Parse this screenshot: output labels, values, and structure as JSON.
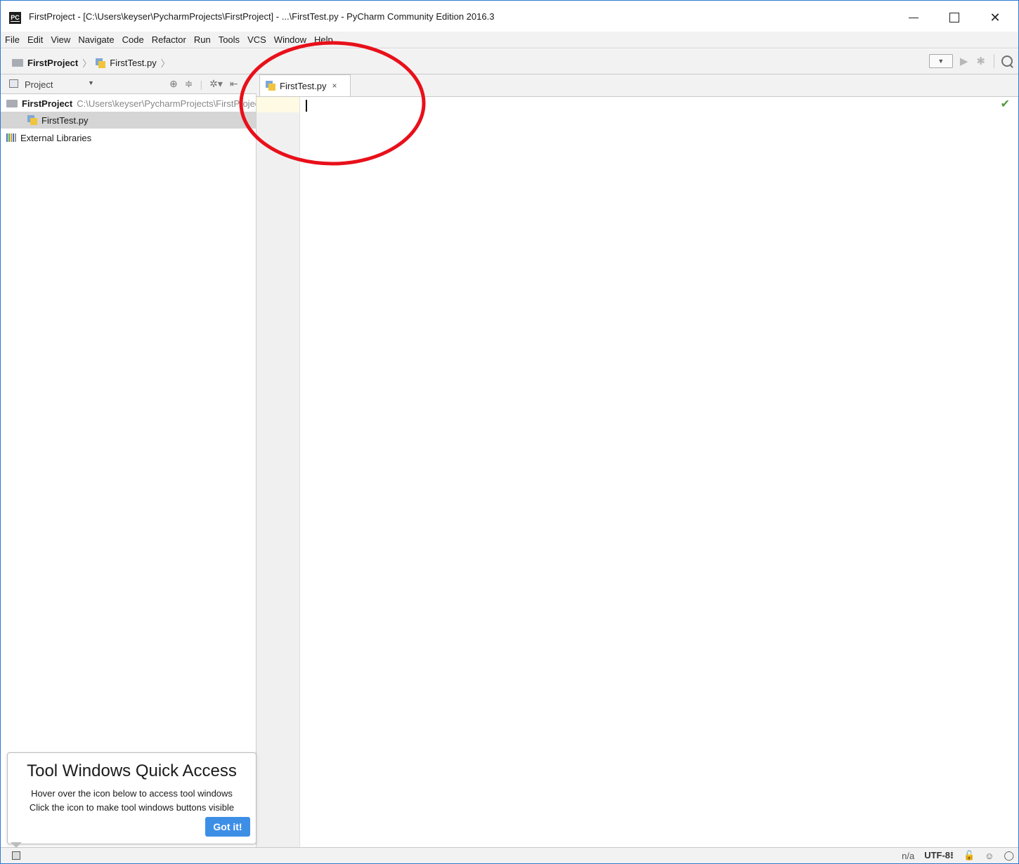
{
  "window": {
    "title": "FirstProject - [C:\\Users\\keyser\\PycharmProjects\\FirstProject] - ...\\FirstTest.py - PyCharm Community Edition 2016.3",
    "logo_text": "PC"
  },
  "menu": {
    "items": [
      "File",
      "Edit",
      "View",
      "Navigate",
      "Code",
      "Refactor",
      "Run",
      "Tools",
      "VCS",
      "Window",
      "Help"
    ]
  },
  "navbar": {
    "project": "FirstProject",
    "file": "FirstTest.py"
  },
  "project_panel": {
    "label": "Project",
    "tree": {
      "root_name": "FirstProject",
      "root_path": "C:\\Users\\keyser\\PycharmProjects\\FirstProject",
      "file": "FirstTest.py",
      "libraries": "External Libraries"
    }
  },
  "editor": {
    "tab_label": "FirstTest.py",
    "tab_close": "×",
    "content": ""
  },
  "tooltip": {
    "title": "Tool Windows Quick Access",
    "line1": "Hover over the icon below to access tool windows",
    "line2": "Click the icon to make tool windows buttons visible",
    "button": "Got it!"
  },
  "statusbar": {
    "position": "n/a",
    "encoding": "UTF-8⁝"
  },
  "colors": {
    "annotation": "#e8101a",
    "accent": "#3d8fe6",
    "ok": "#4e9a3a"
  }
}
